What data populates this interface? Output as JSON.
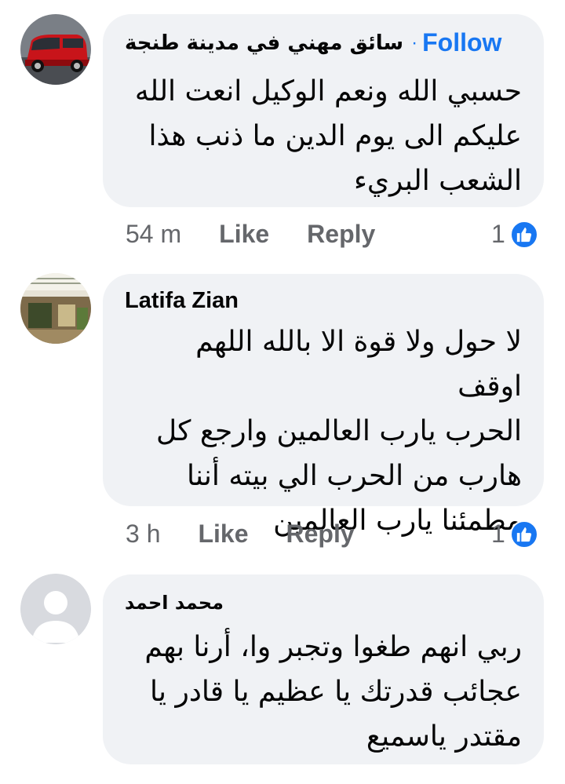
{
  "comments": [
    {
      "author": "سائق مهني في مدينة طنجة",
      "follow_dot": "·",
      "follow_label": "Follow",
      "lines": [
        "حسبي الله ونعم الوكيل انعت الله",
        "عليكم الى يوم الدين ما ذنب هذا",
        "الشعب البريء"
      ],
      "time": "54 m",
      "like_label": "Like",
      "reply_label": "Reply",
      "reaction_count": "1",
      "avatar_icon": "red-van-avatar"
    },
    {
      "author": "Latifa Zian",
      "lines": [
        "لا حول ولا قوة الا بالله اللهم اوقف",
        "الحرب يارب العالمين وارجع كل",
        "هارب من الحرب الي بيته أننا",
        "مطمئنا يارب العالمين"
      ],
      "time": "3 h",
      "like_label": "Like",
      "reply_label": "Reply",
      "reaction_count": "1",
      "avatar_icon": "room-photo-avatar"
    },
    {
      "author": "محمد احمد",
      "lines": [
        "ربي انهم طغوا وتجبر وا، أرنا بهم",
        "عجائب قدرتك يا عظيم يا قادر يا",
        "مقتدر ياسميع"
      ],
      "avatar_icon": "default-user-avatar"
    }
  ],
  "colors": {
    "bubble": "#f0f2f5",
    "accent": "#1877f2",
    "meta": "#65676b"
  }
}
